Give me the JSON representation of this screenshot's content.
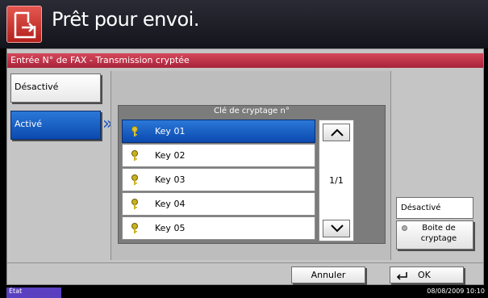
{
  "header": {
    "title": "Prêt pour envoi.",
    "icon": "fax-send-icon"
  },
  "panel": {
    "title": "Entrée N° de FAX - Transmission cryptée",
    "mode_off_label": "Désactivé",
    "mode_on_label": "Activé",
    "list_header": "Clé de cryptage n°",
    "keys": [
      {
        "label": "Key 01",
        "selected": true
      },
      {
        "label": "Key 02",
        "selected": false
      },
      {
        "label": "Key 03",
        "selected": false
      },
      {
        "label": "Key 04",
        "selected": false
      },
      {
        "label": "Key 05",
        "selected": false
      }
    ],
    "page_indicator": "1/1",
    "right_off_label": "Désactivé",
    "right_box_label": "Boite de cryptage"
  },
  "footer": {
    "cancel_label": "Annuler",
    "ok_label": "OK"
  },
  "status_bar": {
    "tab_label": "État",
    "datetime": "08/08/2009   10:10"
  },
  "colors": {
    "selected": "#1a5fd0",
    "titlebar": "#b92c40",
    "status_tab": "#5a3fc0"
  }
}
